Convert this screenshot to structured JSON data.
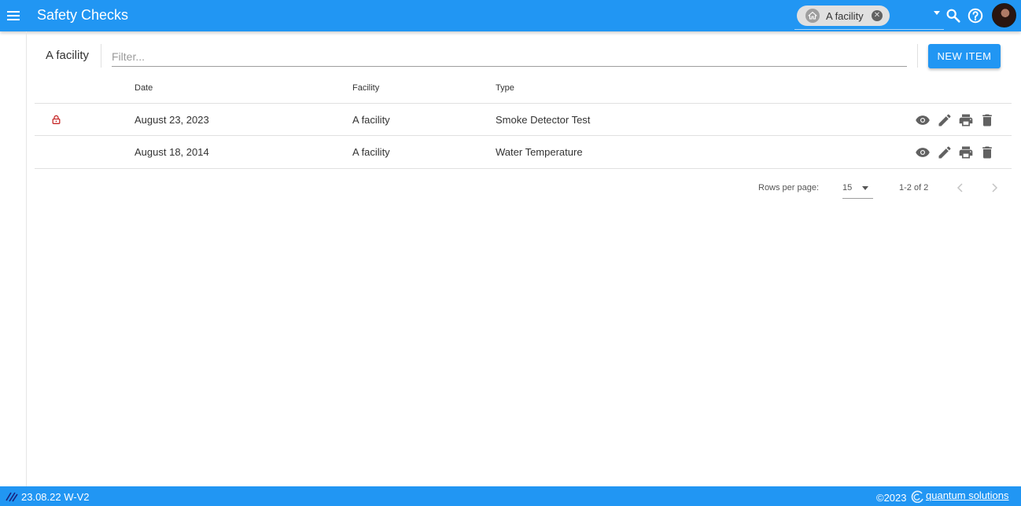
{
  "header": {
    "title": "Safety Checks",
    "facility_chip": "A facility",
    "icons": [
      "menu-icon",
      "home-icon",
      "close-icon",
      "search-icon",
      "help-icon",
      "avatar"
    ]
  },
  "toolbar": {
    "facility_label": "A facility",
    "filter_placeholder": "Filter...",
    "new_button": "NEW ITEM"
  },
  "table": {
    "columns": [
      "Date",
      "Facility",
      "Type"
    ],
    "rows": [
      {
        "locked": true,
        "date": "August 23, 2023",
        "facility": "A facility",
        "type": "Smoke Detector Test"
      },
      {
        "locked": false,
        "date": "August 18, 2014",
        "facility": "A facility",
        "type": "Water Temperature"
      }
    ],
    "row_actions": [
      "view-icon",
      "edit-icon",
      "print-icon",
      "delete-icon"
    ]
  },
  "pagination": {
    "rows_per_page_label": "Rows per page:",
    "rows_per_page": "15",
    "range": "1-2 of 2"
  },
  "footer": {
    "version": "23.08.22 W-V2",
    "copyright": "©2023",
    "brand": "quantum solutions"
  },
  "colors": {
    "primary": "#2196f3",
    "lock": "#c62828",
    "action_icon": "#616161"
  }
}
